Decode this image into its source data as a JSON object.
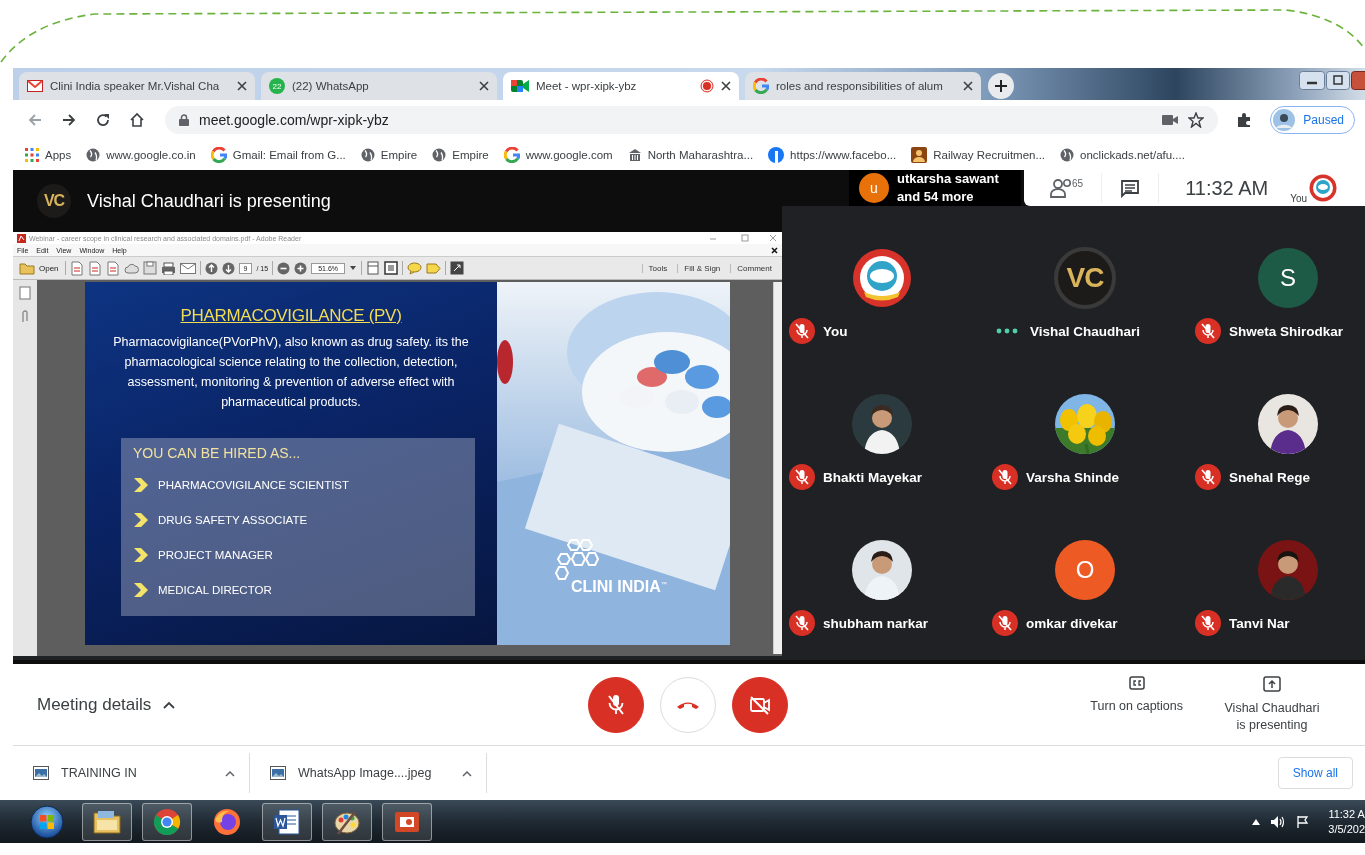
{
  "browser": {
    "tabs": [
      {
        "kind": "mail",
        "title": "Clini India speaker Mr.Vishal Cha",
        "selected": false
      },
      {
        "kind": "chat",
        "badge": "22",
        "title": "(22) WhatsApp",
        "selected": false
      },
      {
        "kind": "meet",
        "title": "Meet - wpr-xipk-ybz",
        "recording": true,
        "selected": true
      },
      {
        "kind": "search",
        "title": "roles and responsibilities of alum",
        "selected": false
      }
    ],
    "address": "meet.google.com/wpr-xipk-ybz",
    "profile_status": "Paused",
    "bookmarks": [
      {
        "kind": "apps",
        "label": "Apps"
      },
      {
        "kind": "globe",
        "label": "www.google.co.in"
      },
      {
        "kind": "ring",
        "label": "Gmail: Email from G..."
      },
      {
        "kind": "globe",
        "label": "Empire"
      },
      {
        "kind": "globe",
        "label": "Empire"
      },
      {
        "kind": "ring",
        "label": "www.google.com"
      },
      {
        "kind": "building",
        "label": "North Maharashtra..."
      },
      {
        "kind": "round",
        "label": "https://www.facebo..."
      },
      {
        "kind": "person",
        "label": "Railway Recruitmen..."
      },
      {
        "kind": "globe",
        "label": "onclickads.net/afu...."
      }
    ]
  },
  "meet": {
    "presenter_banner": {
      "monogram": "VC",
      "text": "Vishal Chaudhari is presenting"
    },
    "join_notice": {
      "initial": "u",
      "name": "utkarsha sawant",
      "more": "and 54 more"
    },
    "people_count": "65",
    "time": "11:32 AM",
    "self_label": "You",
    "shared_window": {
      "title": "Webinar - career scope in clinical research and associated domains.pdf - Adobe Reader",
      "menu": [
        "File",
        "Edit",
        "View",
        "Window",
        "Help"
      ],
      "open_label": "Open",
      "page": "9",
      "page_total": "/ 15",
      "zoom": "51.6%",
      "right_buttons": [
        "Tools",
        "Fill & Sign",
        "Comment"
      ],
      "slide": {
        "title": "PHARMACOVIGILANCE (PV)",
        "body": "Pharmacovigilance(PVorPhV), also known as drug safety. its the pharmacological science relating to the collection, detection, assessment, monitoring & prevention of adverse effect with pharmaceutical products.",
        "box_heading": "YOU CAN BE HIRED AS...",
        "roles": [
          "PHARMACOVIGILANCE SCIENTIST",
          "DRUG SAFETY ASSOCIATE",
          "PROJECT MANAGER",
          "MEDICAL DIRECTOR"
        ],
        "brand": "CLINI INDIA",
        "brand_mark": "™"
      }
    },
    "participants": [
      {
        "name": "You",
        "kind": "logo",
        "muted": true
      },
      {
        "name": "Vishal Chaudhari",
        "kind": "monogram",
        "monogram": "VC",
        "muted": false
      },
      {
        "name": "Shweta Shirodkar",
        "kind": "initial",
        "initial": "S",
        "color": "#1e5b46",
        "muted": true
      },
      {
        "name": "Bhakti Mayekar",
        "muted": true
      },
      {
        "name": "Varsha Shinde",
        "muted": true
      },
      {
        "name": "Snehal Rege",
        "muted": true
      },
      {
        "name": "shubham narkar",
        "muted": true
      },
      {
        "name": "omkar divekar",
        "kind": "initial",
        "initial": "O",
        "color": "#ee5a24",
        "muted": true
      },
      {
        "name": "Tanvi Nar",
        "muted": true
      }
    ],
    "controls": {
      "mic_on": false,
      "camera_on": false
    },
    "meeting_details": "Meeting details",
    "captions": "Turn on captions",
    "presenting": "Vishal Chaudhari is presenting"
  },
  "downloads": {
    "items": [
      {
        "name": "TRAINING IN"
      },
      {
        "name": "WhatsApp Image....jpeg"
      }
    ],
    "show_all": "Show all"
  },
  "taskbar": {
    "apps": [
      {
        "kind": "start",
        "running": false
      },
      {
        "kind": "folder",
        "running": true
      },
      {
        "kind": "chrome",
        "running": true
      },
      {
        "kind": "firefox",
        "running": false
      },
      {
        "kind": "word",
        "running": true
      },
      {
        "kind": "paint",
        "running": true
      },
      {
        "kind": "slides",
        "running": true
      }
    ],
    "time": "11:32 A",
    "date": "3/5/202"
  }
}
